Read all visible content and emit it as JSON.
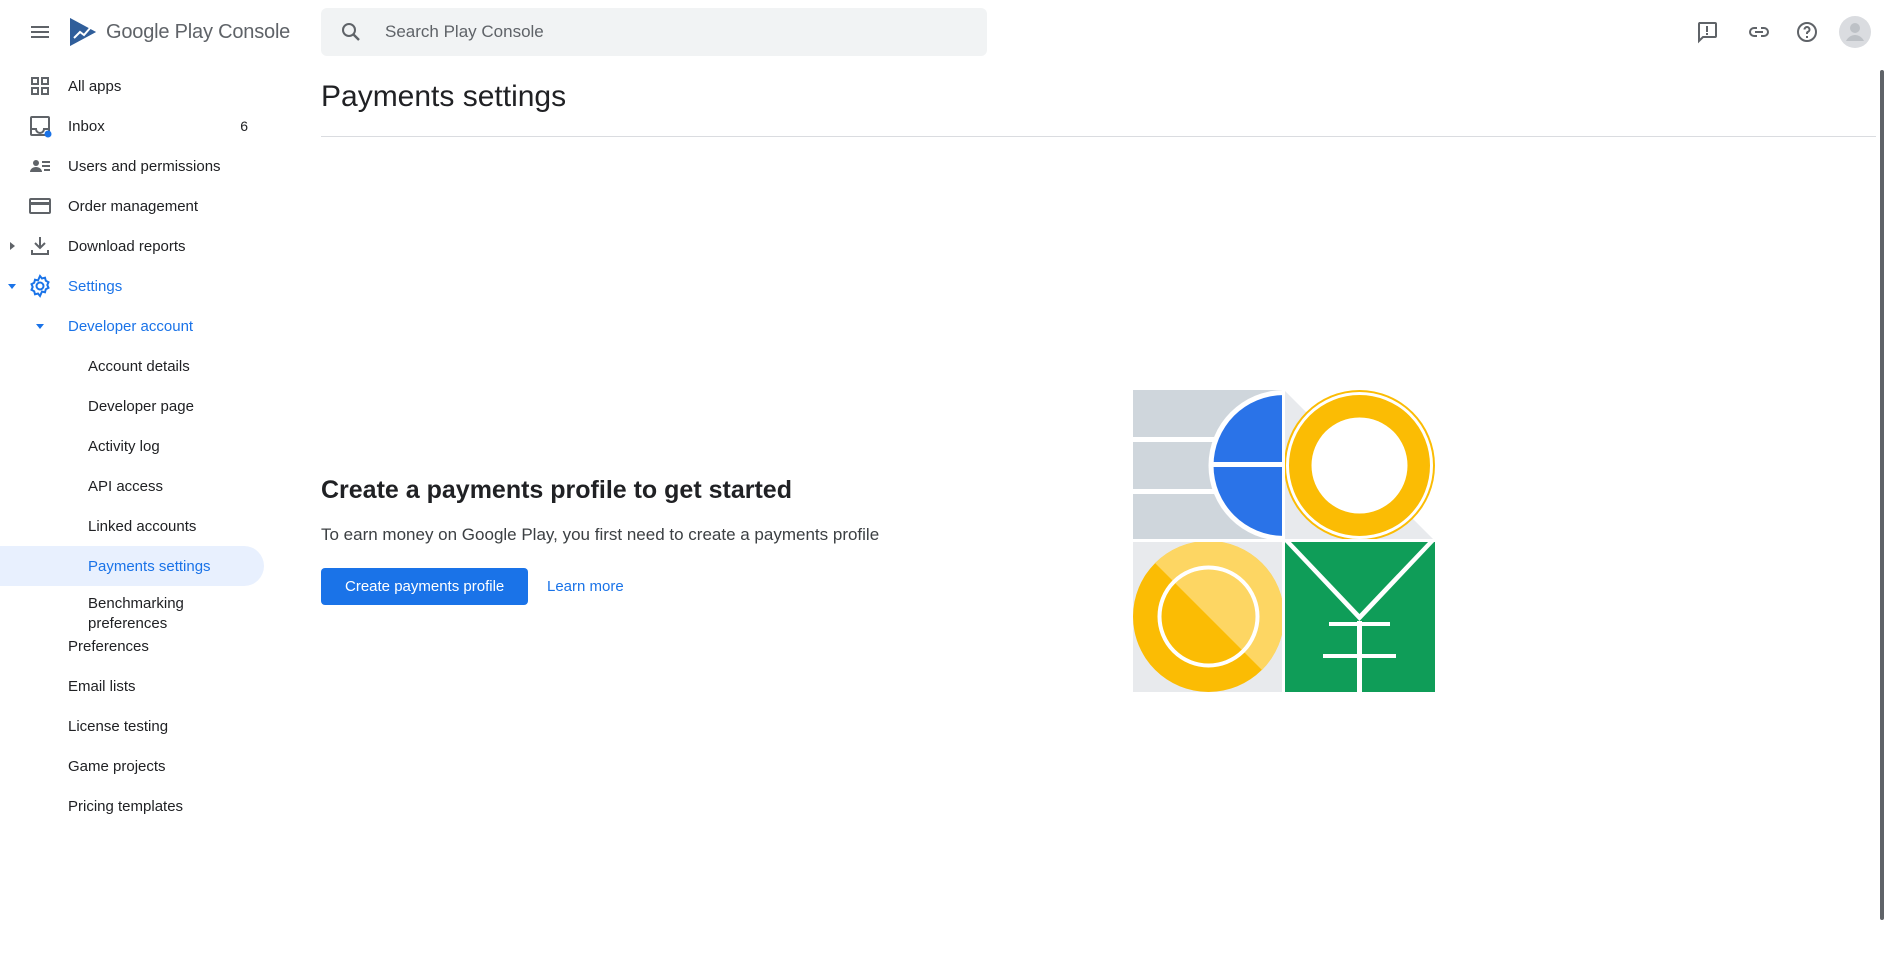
{
  "app": {
    "logo_text_brand": "Google Play",
    "logo_text_product": "Console"
  },
  "search": {
    "placeholder": "Search Play Console",
    "value": ""
  },
  "sidebar": {
    "items": [
      {
        "label": "All apps",
        "icon": "grid-icon"
      },
      {
        "label": "Inbox",
        "icon": "inbox-icon",
        "badge": "6"
      },
      {
        "label": "Users and permissions",
        "icon": "users-icon"
      },
      {
        "label": "Order management",
        "icon": "credit-card-icon"
      },
      {
        "label": "Download reports",
        "icon": "download-icon"
      },
      {
        "label": "Settings",
        "icon": "gear-icon"
      },
      {
        "label": "Developer account"
      },
      {
        "label": "Account details"
      },
      {
        "label": "Developer page"
      },
      {
        "label": "Activity log"
      },
      {
        "label": "API access"
      },
      {
        "label": "Linked accounts"
      },
      {
        "label": "Payments settings"
      },
      {
        "label": "Benchmarking preferences"
      },
      {
        "label": "Preferences"
      },
      {
        "label": "Email lists"
      },
      {
        "label": "License testing"
      },
      {
        "label": "Game projects"
      },
      {
        "label": "Pricing templates"
      }
    ]
  },
  "main": {
    "title": "Payments settings",
    "empty_state": {
      "heading": "Create a payments profile to get started",
      "description": "To earn money on Google Play, you first need to create a payments profile",
      "primary_button": "Create payments profile",
      "link": "Learn more"
    }
  },
  "colors": {
    "accent": "#1a73e8",
    "selected_bg": "#e8f0fe",
    "illustration_blue": "#2a73e8",
    "illustration_yellow": "#fbbc04",
    "illustration_green": "#0f9d58"
  }
}
